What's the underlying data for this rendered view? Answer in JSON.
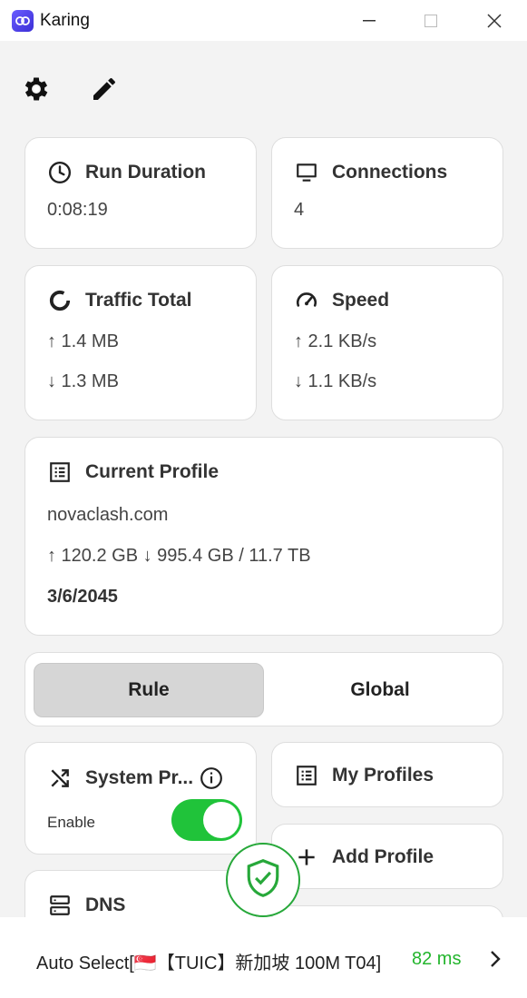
{
  "window": {
    "title": "Karing"
  },
  "cards": {
    "run_duration": {
      "title": "Run Duration",
      "value": "0:08:19"
    },
    "connections": {
      "title": "Connections",
      "value": "4"
    },
    "traffic_total": {
      "title": "Traffic Total",
      "up": "↑ 1.4 MB",
      "down": "↓ 1.3 MB"
    },
    "speed": {
      "title": "Speed",
      "up": "↑ 2.1 KB/s",
      "down": "↓ 1.1 KB/s"
    },
    "current_profile": {
      "title": "Current Profile",
      "name": "novaclash.com",
      "usage": "↑ 120.2 GB ↓ 995.4 GB / 11.7 TB",
      "expiry": "3/6/2045"
    }
  },
  "mode": {
    "options": [
      "Rule",
      "Global"
    ],
    "selected": "Rule"
  },
  "system_proxy": {
    "title": "System Pr...",
    "enable_label": "Enable",
    "enabled": true
  },
  "my_profiles": {
    "label": "My Profiles"
  },
  "add_profile": {
    "label": "Add Profile"
  },
  "dns": {
    "label": "DNS"
  },
  "bottom": {
    "server": "Auto Select[🇸🇬【TUIC】新加坡 100M T04]",
    "latency": "82 ms"
  },
  "colors": {
    "accent_green": "#20c33a",
    "latency_green": "#22b52c"
  }
}
